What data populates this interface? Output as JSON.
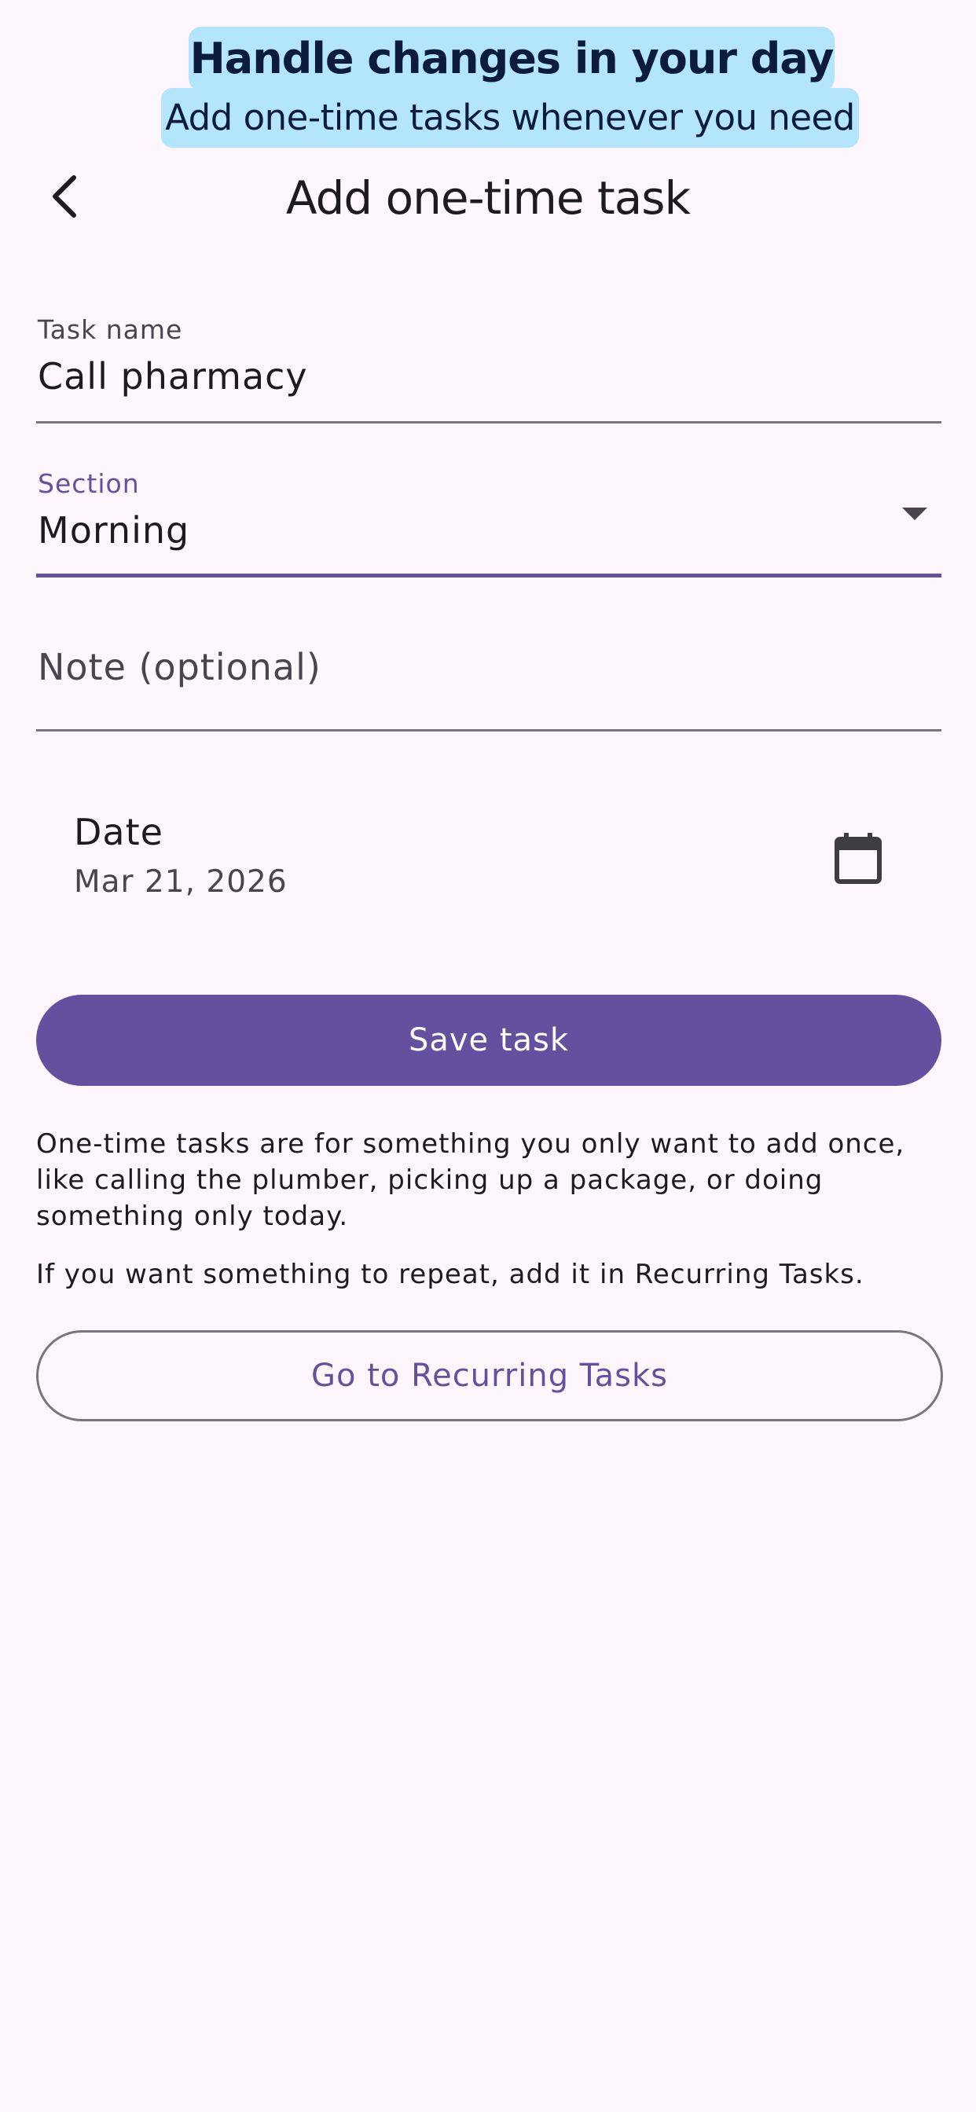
{
  "banner": {
    "title": "Handle changes in your day",
    "subtitle": "Add one-time tasks whenever you need"
  },
  "top_bar": {
    "title": "Add one-time task",
    "back_icon": "chevron-left-icon"
  },
  "form": {
    "task_name": {
      "label": "Task name",
      "value": "Call pharmacy"
    },
    "section": {
      "label": "Section",
      "value": "Morning",
      "accent_color": "#65509f"
    },
    "note": {
      "placeholder": "Note (optional)",
      "value": ""
    },
    "date": {
      "label": "Date",
      "value": "Mar 21, 2026",
      "icon": "calendar-icon"
    }
  },
  "actions": {
    "save_label": "Save task",
    "recurring_label": "Go to Recurring Tasks"
  },
  "info": {
    "paragraph1": "One-time tasks are for something you only want to add once, like calling the plumber, picking up a package, or doing something only today.",
    "paragraph2": "If you want something to repeat, add it in Recurring Tasks."
  },
  "colors": {
    "background": "#fdf7fd",
    "primary": "#65509f",
    "banner": "#b3e5fc",
    "outline": "#79747e"
  }
}
